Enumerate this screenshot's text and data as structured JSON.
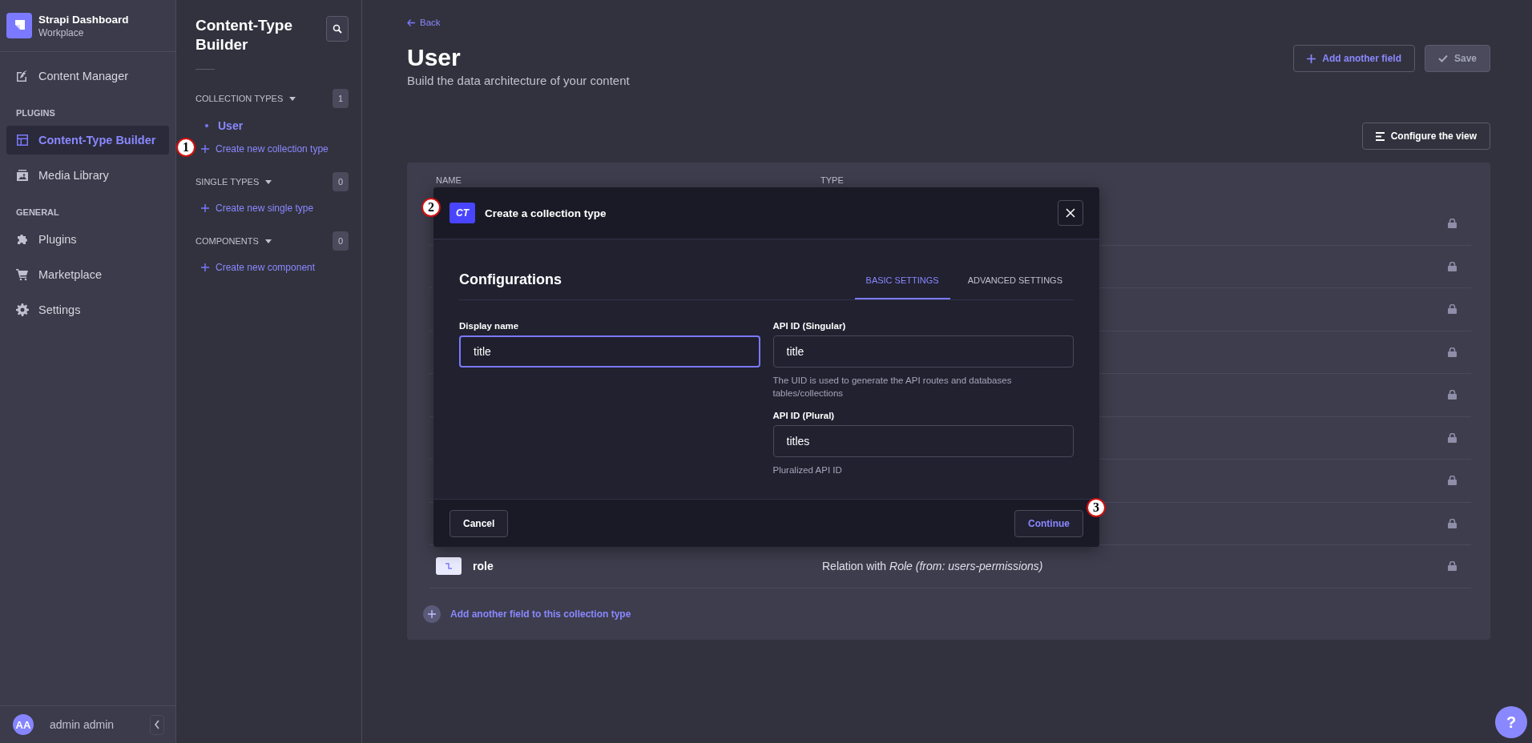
{
  "app": {
    "name": "Strapi Dashboard",
    "workspace": "Workplace"
  },
  "nav": [
    {
      "items": [
        {
          "label": "Content Manager",
          "selected": false
        }
      ]
    },
    {
      "title": "PLUGINS",
      "items": [
        {
          "label": "Content-Type Builder",
          "selected": true
        },
        {
          "label": "Media Library",
          "selected": false
        }
      ]
    },
    {
      "title": "GENERAL",
      "items": [
        {
          "label": "Plugins",
          "selected": false
        },
        {
          "label": "Marketplace",
          "selected": false
        },
        {
          "label": "Settings",
          "selected": false
        }
      ]
    }
  ],
  "user": {
    "initials": "AA",
    "name": "admin admin"
  },
  "builder": {
    "title": "Content-Type Builder",
    "groups": [
      {
        "title": "COLLECTION TYPES",
        "count": "1",
        "expanded": true,
        "items": [
          {
            "label": "User",
            "selected": true
          }
        ],
        "create": "Create new collection type"
      },
      {
        "title": "SINGLE TYPES",
        "count": "0",
        "expanded": true,
        "create": "Create new single type"
      },
      {
        "title": "COMPONENTS",
        "count": "0",
        "expanded": true,
        "create": "Create new component"
      }
    ]
  },
  "header": {
    "back": "Back",
    "title": "User",
    "subtitle": "Build the data architecture of your content",
    "buttons": [
      {
        "label": "Add another field",
        "disabled": false
      },
      {
        "label": "Save",
        "disabled": true
      }
    ],
    "configure": "Configure the view"
  },
  "table": {
    "columns": [
      "NAME",
      "TYPE"
    ],
    "rows": [
      {
        "locked": true
      },
      {
        "locked": true
      },
      {
        "locked": true
      },
      {
        "locked": true
      },
      {
        "locked": true
      },
      {
        "locked": true
      },
      {
        "locked": true
      },
      {
        "locked": true
      },
      {
        "locked": true,
        "name": "role",
        "type": "Relation with *Role (from: users-permissions)*"
      }
    ],
    "add_field": "Add another field to this collection type"
  },
  "modal": {
    "badge": "CT",
    "title": "Create a collection type",
    "heading": "Configurations",
    "tabs": [
      {
        "label": "BASIC SETTINGS",
        "selected": true
      },
      {
        "label": "ADVANCED SETTINGS",
        "selected": false
      }
    ],
    "fields": [
      {
        "label": "Display name",
        "value": "title",
        "focused": true
      },
      {
        "label": "API ID (Singular)",
        "value": "title",
        "focused": false,
        "hint": "The UID is used to generate the API routes and databases tables/collections"
      },
      {
        "label": "API ID (Plural)",
        "value": "titles",
        "focused": false,
        "hint": "Pluralized API ID"
      }
    ],
    "cancel": "Cancel",
    "continue": "Continue"
  },
  "annotations": [
    "1",
    "2",
    "3"
  ],
  "help": "?"
}
